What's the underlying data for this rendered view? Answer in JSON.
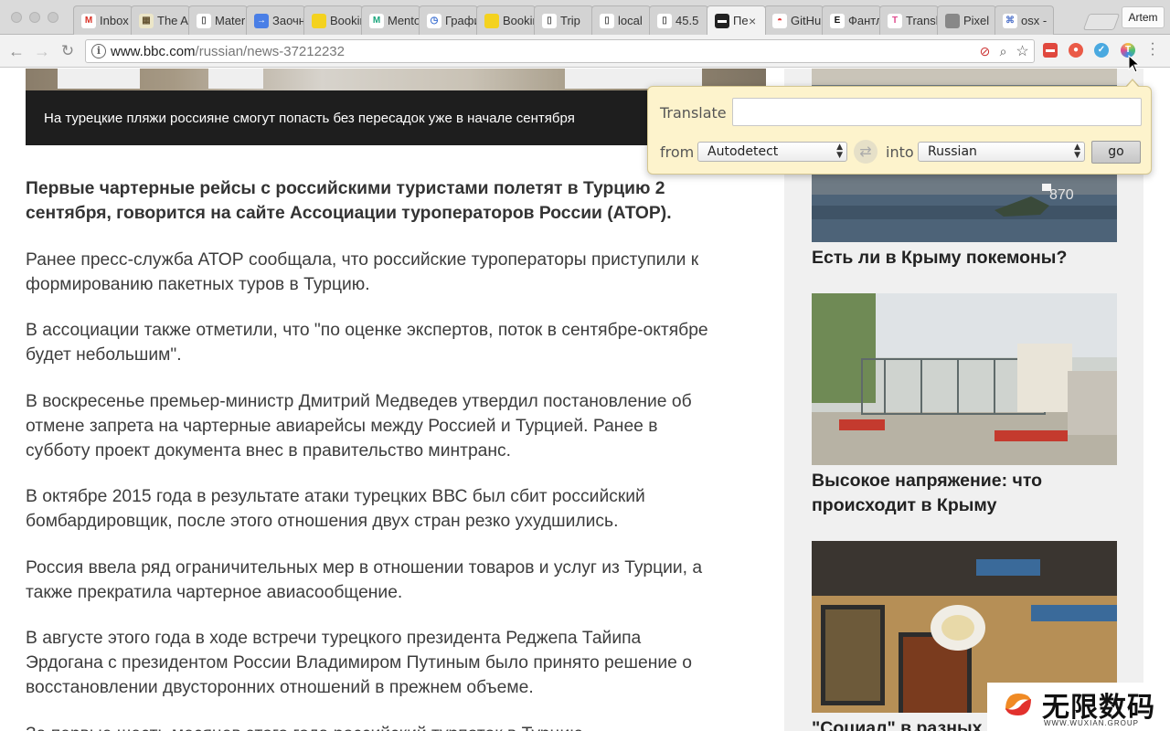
{
  "browser": {
    "tabs": [
      {
        "title": "Inbox",
        "icon": "gmail-icon",
        "color": "#ffffff",
        "glyph": "M",
        "glyph_color": "#d93025"
      },
      {
        "title": "The Art",
        "icon": "picture-icon",
        "color": "#ece6c8",
        "glyph": "▦",
        "glyph_color": "#665533"
      },
      {
        "title": "Material",
        "icon": "document-icon",
        "color": "#ffffff",
        "glyph": "▯",
        "glyph_color": "#555555"
      },
      {
        "title": "Заочный",
        "icon": "arrow-right-icon",
        "color": "#4a7fe6",
        "glyph": "→",
        "glyph_color": "#ffffff"
      },
      {
        "title": "Booking",
        "icon": "yellow-blob-icon",
        "color": "#f4d21f",
        "glyph": "",
        "glyph_color": "#ffffff"
      },
      {
        "title": "Mentor",
        "icon": "m-logo-icon",
        "color": "#ffffff",
        "glyph": "M",
        "glyph_color": "#1aa57c"
      },
      {
        "title": "График",
        "icon": "clock-icon",
        "color": "#ffffff",
        "glyph": "◷",
        "glyph_color": "#3b6fd1"
      },
      {
        "title": "Booking",
        "icon": "yellow-blob-icon",
        "color": "#f4d21f",
        "glyph": "",
        "glyph_color": "#ffffff"
      },
      {
        "title": "Trip",
        "icon": "document-icon",
        "color": "#ffffff",
        "glyph": "▯",
        "glyph_color": "#555555"
      },
      {
        "title": "local",
        "icon": "document-icon",
        "color": "#ffffff",
        "glyph": "▯",
        "glyph_color": "#555555"
      },
      {
        "title": "45.5",
        "icon": "document-icon",
        "color": "#ffffff",
        "glyph": "▯",
        "glyph_color": "#555555"
      },
      {
        "title": "Пе",
        "icon": "bbc-icon",
        "color": "#222222",
        "glyph": "▬",
        "glyph_color": "#ffffff",
        "active": true,
        "close": "×"
      },
      {
        "title": "GitHub",
        "icon": "rainbow-icon",
        "color": "#ffffff",
        "glyph": "◓",
        "glyph_color": "#e23c3c"
      },
      {
        "title": "Фантлаб",
        "icon": "e-logo-icon",
        "color": "#ffffff",
        "glyph": "E",
        "glyph_color": "#111111"
      },
      {
        "title": "Translate",
        "icon": "translate-icon",
        "color": "#ffffff",
        "glyph": "T",
        "glyph_color": "#e04b8e"
      },
      {
        "title": "Pixel",
        "icon": "apple-icon",
        "color": "#888888",
        "glyph": "",
        "glyph_color": "#ffffff"
      },
      {
        "title": "osx -",
        "icon": "hash-icon",
        "color": "#ffffff",
        "glyph": "⌘",
        "glyph_color": "#5577cc"
      }
    ],
    "profile_label": "Artem",
    "url_host": "www.bbc.com",
    "url_path": "/russian/news-37212232"
  },
  "page": {
    "caption": "На турецкие пляжи россияне смогут попасть без пересадок уже в начале сентября",
    "lead": "Первые чартерные рейсы с российскими туристами полетят в Турцию 2 сентября, говорится на сайте Ассоциации туроператоров России (АТОР).",
    "paragraphs": [
      "Ранее пресс-служба АТОР сообщала, что российские туроператоры приступили к формированию пакетных туров в Турцию.",
      "В ассоциации также отметили, что \"по оценке экспертов, поток в сентябре-октябре будет небольшим\".",
      "В воскресенье премьер-министр Дмитрий Медведев утвердил постановление об отмене запрета на чартерные авиарейсы между Россией и Турцией. Ранее в субботу проект документа внес в правительство минтранс.",
      "В октябре 2015 года в результате атаки турецких ВВС был сбит российский бомбардировщик, после этого отношения двух стран резко ухудшились.",
      "Россия ввела ряд ограничительных мер в отношении товаров и услуг из Турции, а также прекратила чартерное авиасообщение.",
      "В августе этого года в ходе встречи турецкого президента Реджепа Тайипа Эрдогана с президентом России Владимиром Путиным было принято решение о восстановлении двусторонних отношений в прежнем объеме.",
      "За первые шесть месяцев этого года российский турпоток в Турцию"
    ],
    "sidebar": [
      {
        "title": "Есть ли в Крыму покемоны?"
      },
      {
        "title": "Высокое напряжение: что происходит в Крыму"
      },
      {
        "title": "\"Социал\" в разных"
      }
    ],
    "ship_number": "870"
  },
  "translate_popup": {
    "translate_label": "Translate",
    "input_value": "",
    "from_label": "from",
    "from_value": "Autodetect",
    "into_label": "into",
    "into_value": "Russian",
    "go_label": "go"
  },
  "watermark": {
    "title": "无限数码",
    "subtitle": "WWW.WUXIAN.GROUP"
  }
}
